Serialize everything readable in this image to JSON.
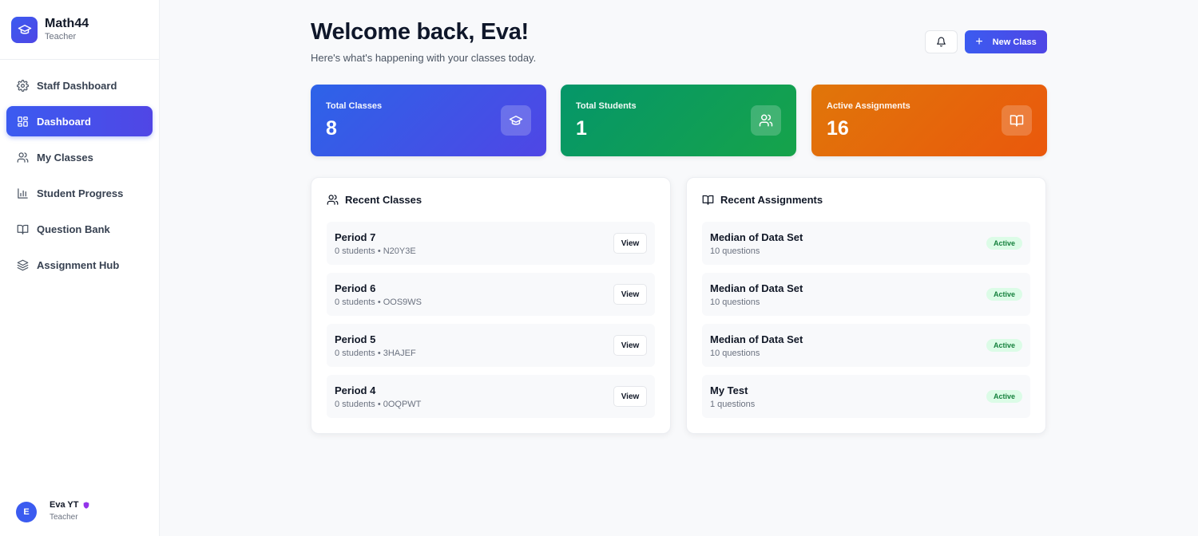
{
  "app": {
    "name": "Math44",
    "role": "Teacher"
  },
  "nav": [
    {
      "label": "Staff Dashboard",
      "icon": "gear-icon"
    },
    {
      "label": "Dashboard",
      "icon": "dashboard-grid-icon",
      "active": true
    },
    {
      "label": "My Classes",
      "icon": "users-icon"
    },
    {
      "label": "Student Progress",
      "icon": "bar-chart-icon"
    },
    {
      "label": "Question Bank",
      "icon": "book-icon"
    },
    {
      "label": "Assignment Hub",
      "icon": "layers-icon"
    }
  ],
  "user": {
    "initial": "E",
    "name": "Eva YT",
    "role": "Teacher",
    "badge_color": "#9333ea"
  },
  "header": {
    "title": "Welcome back, Eva!",
    "subtitle": "Here's what's happening with your classes today.",
    "new_class_label": "New Class"
  },
  "stats": [
    {
      "label": "Total Classes",
      "value": "8",
      "icon": "graduation-cap-icon",
      "color": "#2d63e8"
    },
    {
      "label": "Total Students",
      "value": "1",
      "icon": "users-icon",
      "color": "#059669"
    },
    {
      "label": "Active Assignments",
      "value": "16",
      "icon": "book-icon",
      "color": "#ea580c"
    }
  ],
  "recent_classes": {
    "title": "Recent Classes",
    "view_label": "View",
    "items": [
      {
        "name": "Period 7",
        "meta": "0 students • N20Y3E"
      },
      {
        "name": "Period 6",
        "meta": "0 students • OOS9WS"
      },
      {
        "name": "Period 5",
        "meta": "0 students • 3HAJEF"
      },
      {
        "name": "Period 4",
        "meta": "0 students • 0OQPWT"
      }
    ]
  },
  "recent_assignments": {
    "title": "Recent Assignments",
    "items": [
      {
        "name": "Median of Data Set",
        "meta": "10 questions",
        "status": "Active"
      },
      {
        "name": "Median of Data Set",
        "meta": "10 questions",
        "status": "Active"
      },
      {
        "name": "Median of Data Set",
        "meta": "10 questions",
        "status": "Active"
      },
      {
        "name": "My Test",
        "meta": "1 questions",
        "status": "Active"
      }
    ]
  }
}
